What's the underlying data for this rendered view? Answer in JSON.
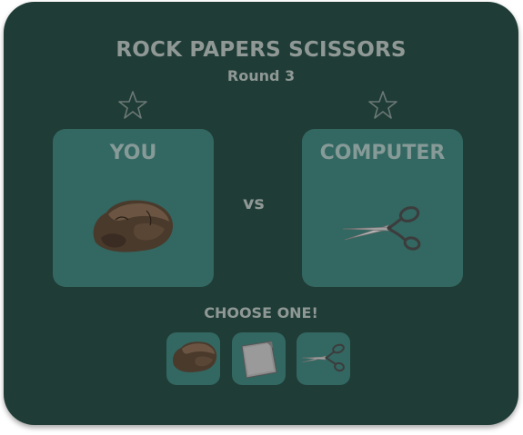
{
  "game": {
    "title": "ROCK PAPERS SCISSORS",
    "round_label": "Round 3",
    "vs_label": "vs",
    "choose_label": "CHOOSE ONE!"
  },
  "player": {
    "label": "YOU",
    "selection": "rock",
    "score_star": "empty-star-icon"
  },
  "computer": {
    "label": "COMPUTER",
    "selection": "scissors",
    "score_star": "empty-star-icon"
  },
  "choices": [
    {
      "name": "rock",
      "icon": "rock-icon"
    },
    {
      "name": "paper",
      "icon": "paper-icon"
    },
    {
      "name": "scissors",
      "icon": "scissors-icon"
    }
  ],
  "colors": {
    "background": "#1f3c36",
    "panel": "#336761",
    "text": "#8f9895"
  }
}
